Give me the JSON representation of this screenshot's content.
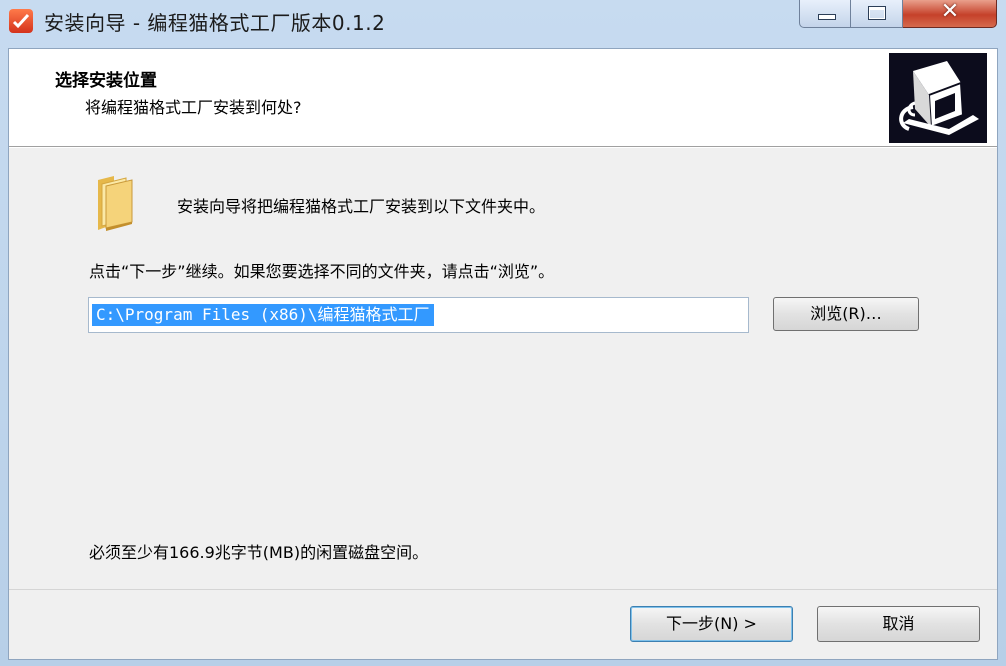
{
  "window": {
    "title": "安装向导 - 编程猫格式工厂版本0.1.2",
    "controls": {
      "minimize_icon": "minimize-icon",
      "maximize_icon": "maximize-icon",
      "close_label": "✕"
    }
  },
  "header": {
    "title": "选择安装位置",
    "subtitle": "将编程猫格式工厂安装到何处?"
  },
  "content": {
    "intro": "安装向导将把编程猫格式工厂安装到以下文件夹中。",
    "instruction": "点击“下一步”继续。如果您要选择不同的文件夹，请点击“浏览”。",
    "path_value": "C:\\Program Files (x86)\\编程猫格式工厂",
    "browse_label": "浏览(R)…",
    "space_required": "必须至少有166.9兆字节(MB)的闲置磁盘空间。"
  },
  "footer": {
    "next_label": "下一步(N) >",
    "cancel_label": "取消"
  },
  "colors": {
    "selection": "#3399ff",
    "header_bg": "#ffffff",
    "dialog_bg": "#f0f0f0",
    "logo_bg": "#0c0c1c"
  }
}
